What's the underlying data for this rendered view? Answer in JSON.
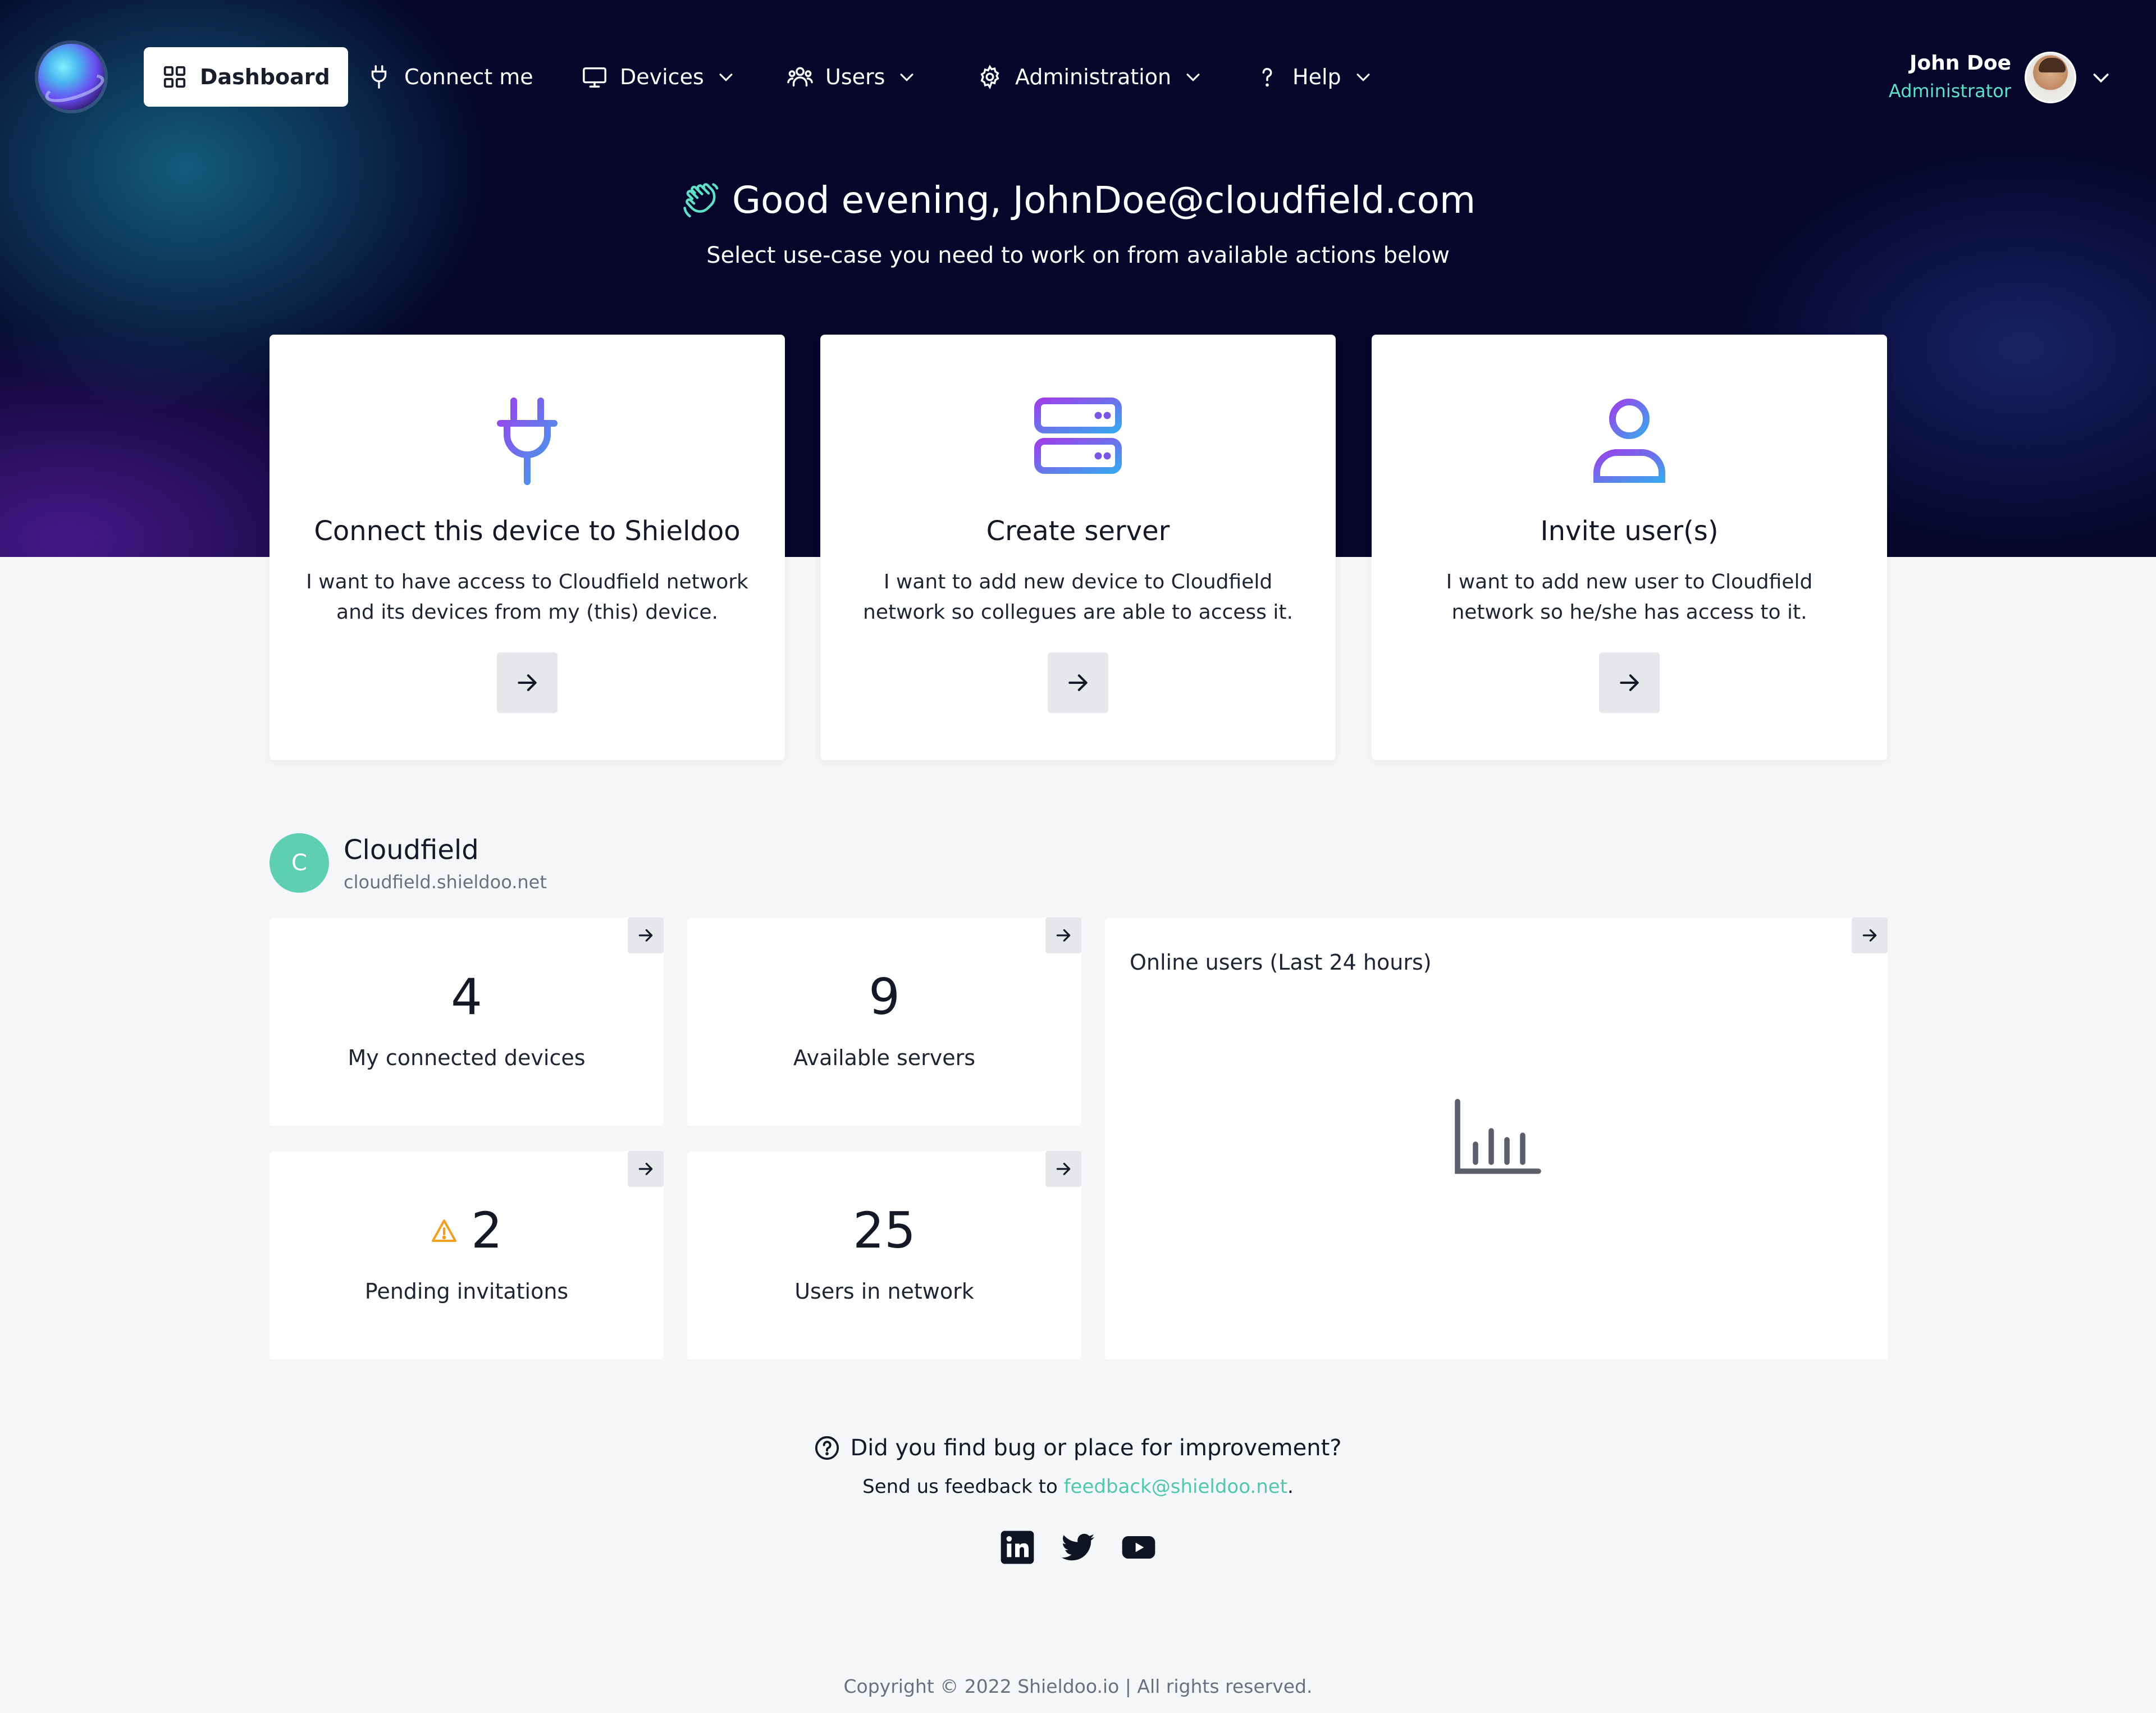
{
  "nav": {
    "items": [
      {
        "label": "Dashboard"
      },
      {
        "label": "Connect me"
      },
      {
        "label": "Devices"
      },
      {
        "label": "Users"
      },
      {
        "label": "Administration"
      },
      {
        "label": "Help"
      }
    ],
    "user": {
      "name": "John Doe",
      "role": "Administrator"
    }
  },
  "hero": {
    "greeting_prefix": "Good evening,",
    "greeting_email": "JohnDoe@cloudfield.com",
    "subtitle": "Select use-case you need to work on from available actions below"
  },
  "actions": [
    {
      "title": "Connect this device to Shieldoo",
      "desc_line1": "I want to have access to Cloudfield network",
      "desc_line2": "and its devices from my (this) device."
    },
    {
      "title": "Create server",
      "desc_line1": "I want to add new device to Cloudfield",
      "desc_line2": "network so collegues are able to access it."
    },
    {
      "title": "Invite user(s)",
      "desc_line1": "I want to add new user to Cloudfield",
      "desc_line2": "network so he/she has access to it."
    }
  ],
  "org": {
    "initial": "C",
    "name": "Cloudfield",
    "domain": "cloudfield.shieldoo.net"
  },
  "stats": [
    {
      "value": "4",
      "label": "My connected devices"
    },
    {
      "value": "9",
      "label": "Available servers"
    },
    {
      "value": "2",
      "label": "Pending invitations"
    },
    {
      "value": "25",
      "label": "Users in network"
    }
  ],
  "chart": {
    "title": "Online users (Last 24 hours)"
  },
  "footer": {
    "question": "Did you find bug or place for improvement?",
    "send_prefix": "Send us feedback to ",
    "email": "feedback@shieldoo.net",
    "send_suffix": ".",
    "copyright": "Copyright © 2022 Shieldoo.io  |  All rights reserved."
  },
  "colors": {
    "accent": "#5fe0c6",
    "link": "#4fc9a8",
    "warning": "#f0a020",
    "hero_bg": "#05062a"
  }
}
